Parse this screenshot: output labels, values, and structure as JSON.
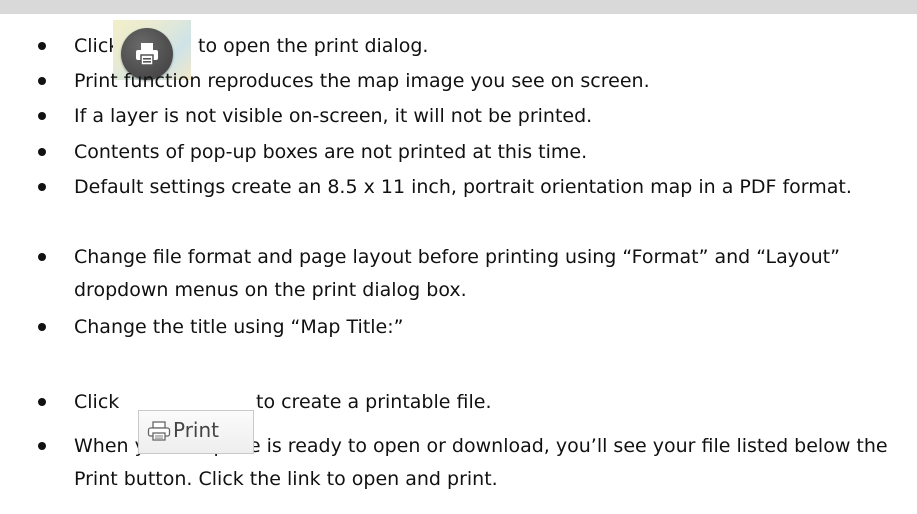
{
  "items": [
    {
      "before": "Click",
      "after": "to open the print dialog."
    },
    {
      "text": "Print function reproduces the map image you see on screen."
    },
    {
      "text": "If a layer is not visible on-screen, it will not be printed."
    },
    {
      "text": "Contents of pop-up boxes are not printed at this time."
    },
    {
      "text": "Default settings create an 8.5 x 11 inch, portrait orientation map in a PDF format."
    },
    {
      "text": "Change file format and page layout before printing using “Format” and “Layout” dropdown menus on the print dialog box."
    },
    {
      "text": "Change the title using “Map Title:”"
    },
    {
      "before": "Click",
      "after": "to create a printable file."
    },
    {
      "text": "When your map file is ready to open or download, you’ll see your file listed below the Print button.  Click the link to open and print."
    }
  ],
  "print_button": {
    "label": "Print"
  },
  "icons": {
    "round_print": "printer-icon",
    "button_print": "printer-icon"
  }
}
